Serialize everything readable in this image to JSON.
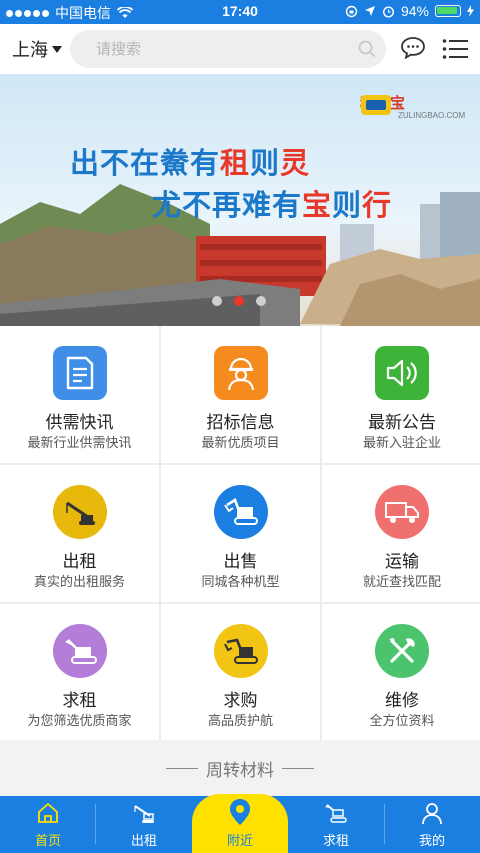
{
  "status_bar": {
    "carrier": "中国电信",
    "time": "17:40",
    "battery": "94%"
  },
  "header": {
    "city": "上海",
    "search_placeholder": "请搜索"
  },
  "banner": {
    "slogan_line1": [
      "出不在鮝有",
      "租",
      "则",
      "灵"
    ],
    "slogan_line2": [
      "尤不再难有",
      "宝",
      "则",
      "行"
    ],
    "logo_text": "租灵宝",
    "logo_url": "ZULINGBAO.COM",
    "active_slide": 2,
    "slide_count": 3
  },
  "grid": [
    {
      "title": "供需快讯",
      "subtitle": "最新行业供需快讯",
      "icon": "document-icon",
      "color": "#3f8ee8",
      "shape": "square"
    },
    {
      "title": "招标信息",
      "subtitle": "最新优质项目",
      "icon": "worker-icon",
      "color": "#f58a1f",
      "shape": "square"
    },
    {
      "title": "最新公告",
      "subtitle": "最新入驻企业",
      "icon": "speaker-icon",
      "color": "#3db33a",
      "shape": "square"
    },
    {
      "title": "出租",
      "subtitle": "真实的出租服务",
      "icon": "crane-icon",
      "color": "#e9b80c",
      "shape": "circle"
    },
    {
      "title": "出售",
      "subtitle": "同城各种机型",
      "icon": "excavator-icon",
      "color": "#1a7fe0",
      "shape": "circle"
    },
    {
      "title": "运输",
      "subtitle": "就近查找匹配",
      "icon": "truck-icon",
      "color": "#f07070",
      "shape": "circle"
    },
    {
      "title": "求租",
      "subtitle": "为您筛选优质商家",
      "icon": "digger-icon",
      "color": "#b47ed8",
      "shape": "circle"
    },
    {
      "title": "求购",
      "subtitle": "高品质护航",
      "icon": "loader-icon",
      "color": "#f2c414",
      "shape": "circle"
    },
    {
      "title": "维修",
      "subtitle": "全方位资料",
      "icon": "tools-icon",
      "color": "#4cc46e",
      "shape": "circle"
    }
  ],
  "section_title": "周转材料",
  "tabs": [
    {
      "label": "首页",
      "icon": "home-icon",
      "active": true
    },
    {
      "label": "出租",
      "icon": "crane-icon",
      "active": false
    },
    {
      "label": "附近",
      "icon": "location-pin-icon",
      "active": false
    },
    {
      "label": "求租",
      "icon": "digger-icon",
      "active": false
    },
    {
      "label": "我的",
      "icon": "user-icon",
      "active": false
    }
  ]
}
